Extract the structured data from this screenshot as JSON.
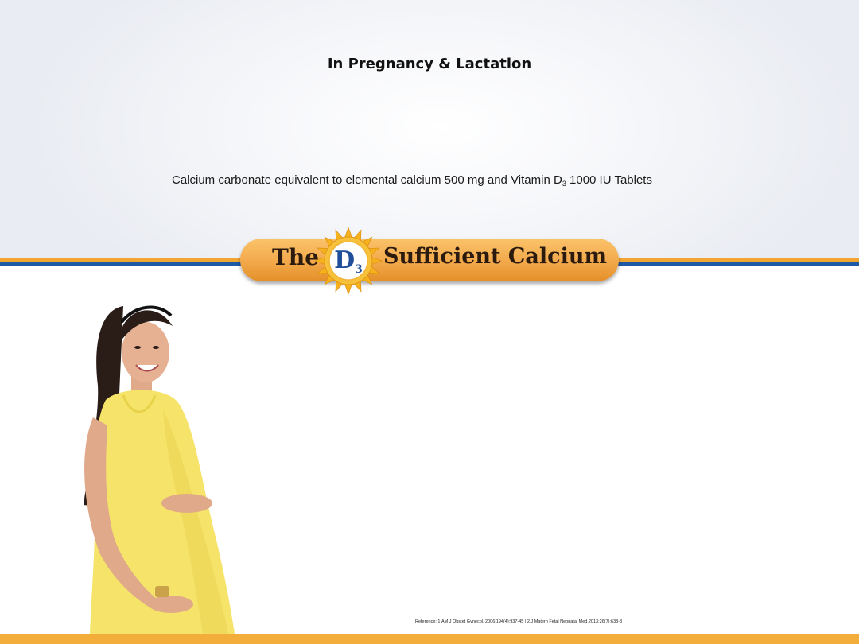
{
  "slide": {
    "title": "In Pregnancy & Lactation",
    "composition_text": "Calcium carbonate equivalent to elemental calcium 500 mg and Vitamin D",
    "composition_subscript": "3",
    "composition_suffix": " 1000 IU Tablets"
  },
  "banner": {
    "word_the": "The",
    "logo_letter": "D",
    "logo_subscript": "3",
    "tagline": "Sufficient Calcium"
  },
  "footer": {
    "reference": "Reference: 1.AM J Obstet Gynecol. 2006;194(4):937-45  |  2.J  Matern Fetal Neonatal Med.2013;26(7):638-8"
  },
  "colors": {
    "accent_orange": "#f2a531",
    "accent_blue": "#1f5aa6",
    "banner_orange": "#f2a84a",
    "dress_yellow": "#f5e469"
  },
  "image": {
    "photo_subject": "pregnant-woman-photo"
  }
}
